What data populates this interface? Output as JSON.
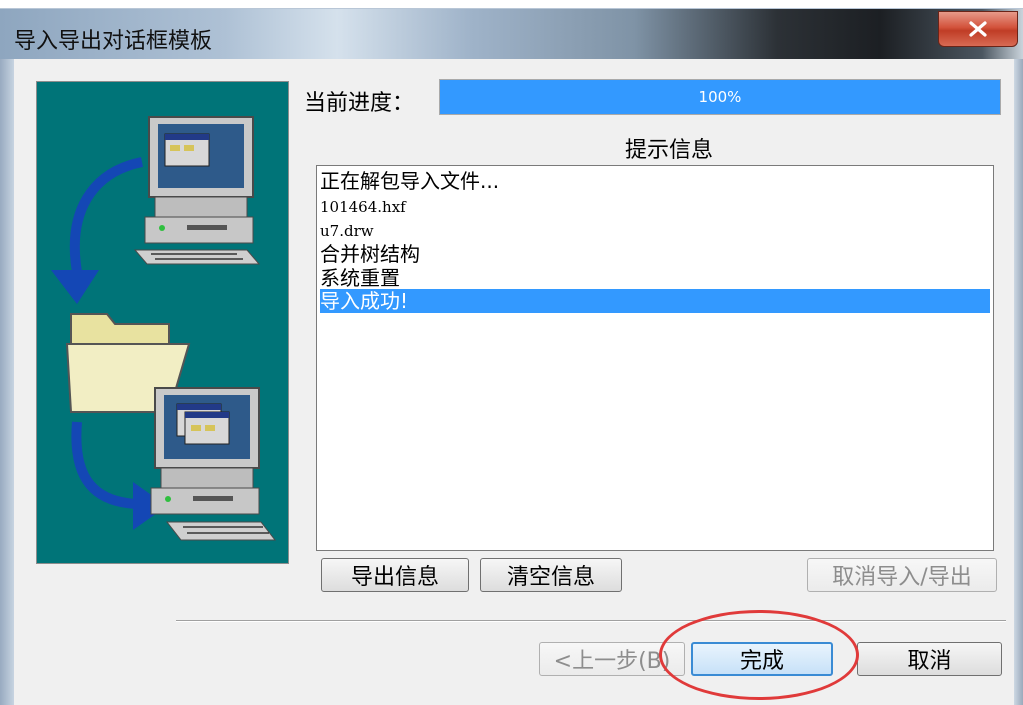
{
  "window": {
    "title": "导入导出对话框模板",
    "close_label": "X"
  },
  "progress": {
    "label": "当前进度：",
    "value_text": "100%",
    "fraction": 1.0,
    "fill_color": "#3399ff"
  },
  "info": {
    "title": "提示信息",
    "lines": [
      "正在解包导入文件...",
      "101464.hxf",
      "u7.drw",
      "合并树结构",
      "系统重置",
      "导入成功!"
    ]
  },
  "buttons": {
    "export_info": "导出信息",
    "clear_info": "清空信息",
    "cancel_import_export": "取消导入/导出",
    "prev": "<上一步(B)",
    "finish": "完成",
    "cancel": "取消"
  },
  "colors": {
    "art_background": "#007478",
    "selection": "#3399ff",
    "annotation": "#e03a3a"
  }
}
